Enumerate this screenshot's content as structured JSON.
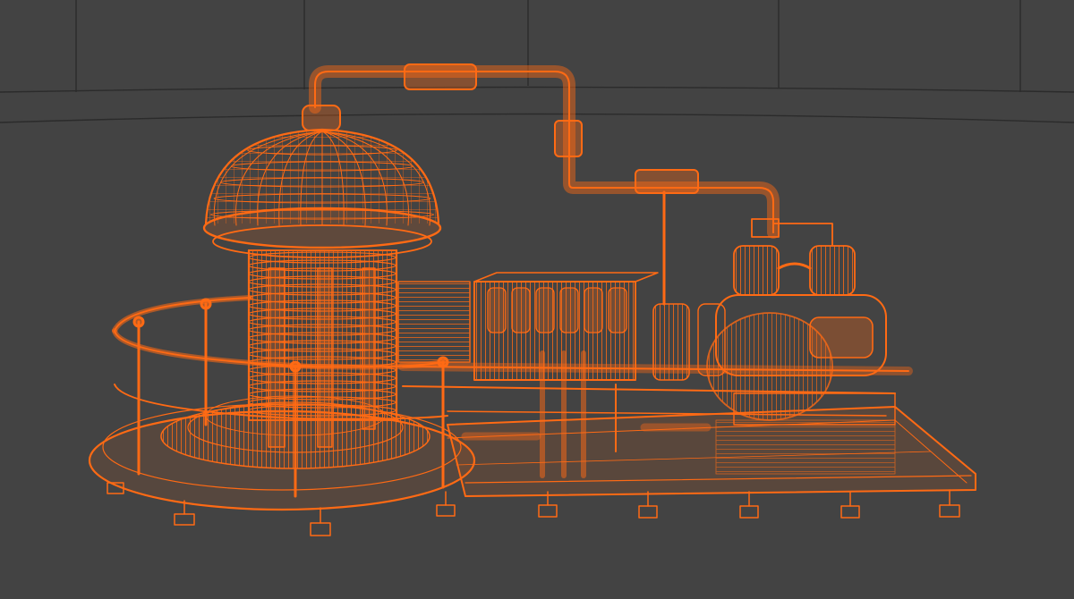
{
  "scene": {
    "background_color": "#434343",
    "grid_line_color": "#2a2a2a",
    "wire_color": "#ff6a14",
    "wire_dark_color": "#c4470a"
  }
}
